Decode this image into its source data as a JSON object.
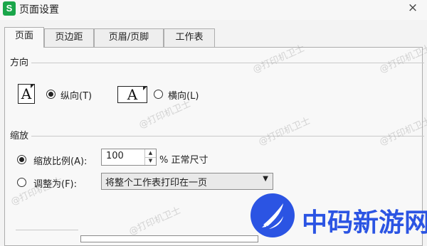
{
  "window": {
    "app_icon_letter": "S",
    "title": "页面设置",
    "close_label": "×"
  },
  "tabs": [
    {
      "label": "页面",
      "active": true
    },
    {
      "label": "页边距",
      "active": false
    },
    {
      "label": "页眉/页脚",
      "active": false
    },
    {
      "label": "工作表",
      "active": false
    }
  ],
  "orientation": {
    "section_label": "方向",
    "portrait": {
      "icon_letter": "A",
      "label": "纵向(T)",
      "selected": true
    },
    "landscape": {
      "icon_letter": "A",
      "label": "横向(L)",
      "selected": false
    }
  },
  "scaling": {
    "section_label": "缩放",
    "scale_option": {
      "label": "缩放比例(A):",
      "selected": true
    },
    "scale_value": "100",
    "scale_suffix": "% 正常尺寸",
    "fit_option": {
      "label": "调整为(F):",
      "selected": false
    },
    "fit_select_value": "将整个工作表打印在一页"
  },
  "watermark_text": "@打印机卫士",
  "overlay_brand": {
    "text": "中码新游网",
    "color": "#2b54e3"
  },
  "colors": {
    "app_icon": "#1aa64a",
    "accent": "#2b54e3"
  }
}
